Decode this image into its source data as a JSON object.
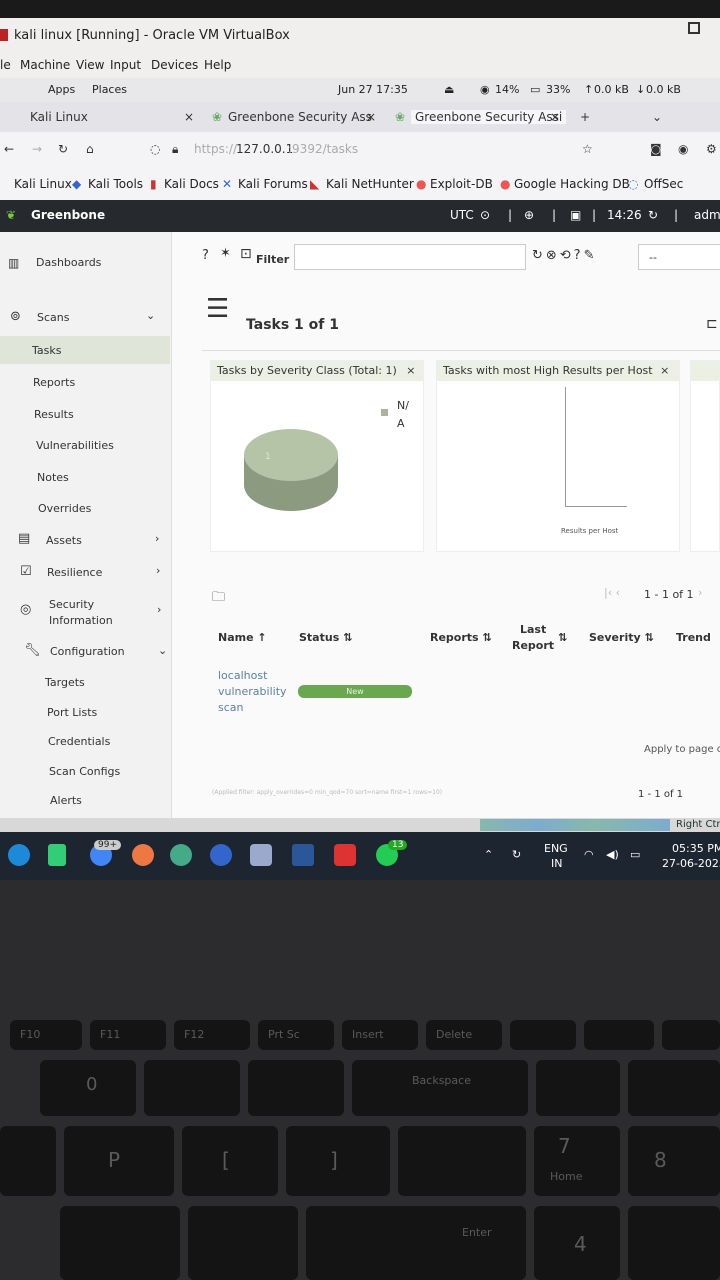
{
  "vbox": {
    "title": "kali linux [Running] - Oracle VM VirtualBox",
    "menu": [
      "le",
      "Machine",
      "View",
      "Input",
      "Devices",
      "Help"
    ]
  },
  "kali_panel": {
    "apps": "Apps",
    "places": "Places",
    "clock": "Jun 27  17:35",
    "cpu": "14%",
    "mem": "33%",
    "up": "0.0 kB",
    "down": "0.0 kB"
  },
  "browser": {
    "tabs": [
      "Kali Linux",
      "Greenbone Security Ass",
      "Greenbone Security Assi"
    ],
    "url_prefix": "https://",
    "url_host": "127.0.0.1",
    "url_path": ":9392/tasks",
    "bookmarks": [
      "Kali Linux",
      "Kali Tools",
      "Kali Docs",
      "Kali Forums",
      "Kali NetHunter",
      "Exploit-DB",
      "Google Hacking DB",
      "OffSec"
    ]
  },
  "greenbone": {
    "brand": "Greenbone",
    "timezone": "UTC",
    "time": "14:26",
    "user": "adm",
    "filter_label": "Filter",
    "filter_select": "--",
    "page_title": "Tasks 1 of 1",
    "sidebar": {
      "dashboards": "Dashboards",
      "scans": "Scans",
      "scans_items": [
        "Tasks",
        "Reports",
        "Results",
        "Vulnerabilities",
        "Notes",
        "Overrides"
      ],
      "assets": "Assets",
      "resilience": "Resilience",
      "security_info_1": "Security",
      "security_info_2": "Information",
      "configuration": "Configuration",
      "config_items": [
        "Targets",
        "Port Lists",
        "Credentials",
        "Scan Configs",
        "Alerts"
      ]
    },
    "charts": {
      "chart1_title": "Tasks by Severity Class (Total: 1)",
      "chart1_slice_label": "1",
      "chart1_legend_1": "N/",
      "chart1_legend_2": "A",
      "chart2_title": "Tasks with most High Results per Host",
      "chart2_axis_label": "Results per Host"
    },
    "pagination": "1 - 1 of 1",
    "table": {
      "headers": [
        "Name",
        "Status",
        "Reports",
        "Last",
        "Report",
        "Severity",
        "Trend"
      ],
      "rows": [
        {
          "name_1": "localhost",
          "name_2": "vulnerability",
          "name_3": "scan",
          "status": "New"
        }
      ]
    },
    "apply_to_page": "Apply to page c",
    "applied_filter": "(Applied filter: apply_overrides=0 min_qod=70 sort=name first=1 rows=10)",
    "pagination_bottom": "1 - 1 of 1"
  },
  "vbox_status": {
    "right_ctrl": "Right Ctr"
  },
  "taskbar": {
    "badge_mail": "99+",
    "badge_whatsapp": "13",
    "lang_1": "ENG",
    "lang_2": "IN",
    "time": "05:35 PM",
    "date": "27-06-2025"
  },
  "keyboard": {
    "keys": [
      "F10",
      "F11",
      "F12",
      "Prt Sc",
      "Insert",
      "Delete",
      "0",
      "P",
      "Backspace",
      "[",
      "]",
      "7",
      "Home",
      "8",
      "Enter",
      "4"
    ]
  },
  "colors": {
    "greenbone_header": "#262a2e",
    "accent_green": "#6aa84f",
    "sidebar_active": "#dfe5d8"
  }
}
